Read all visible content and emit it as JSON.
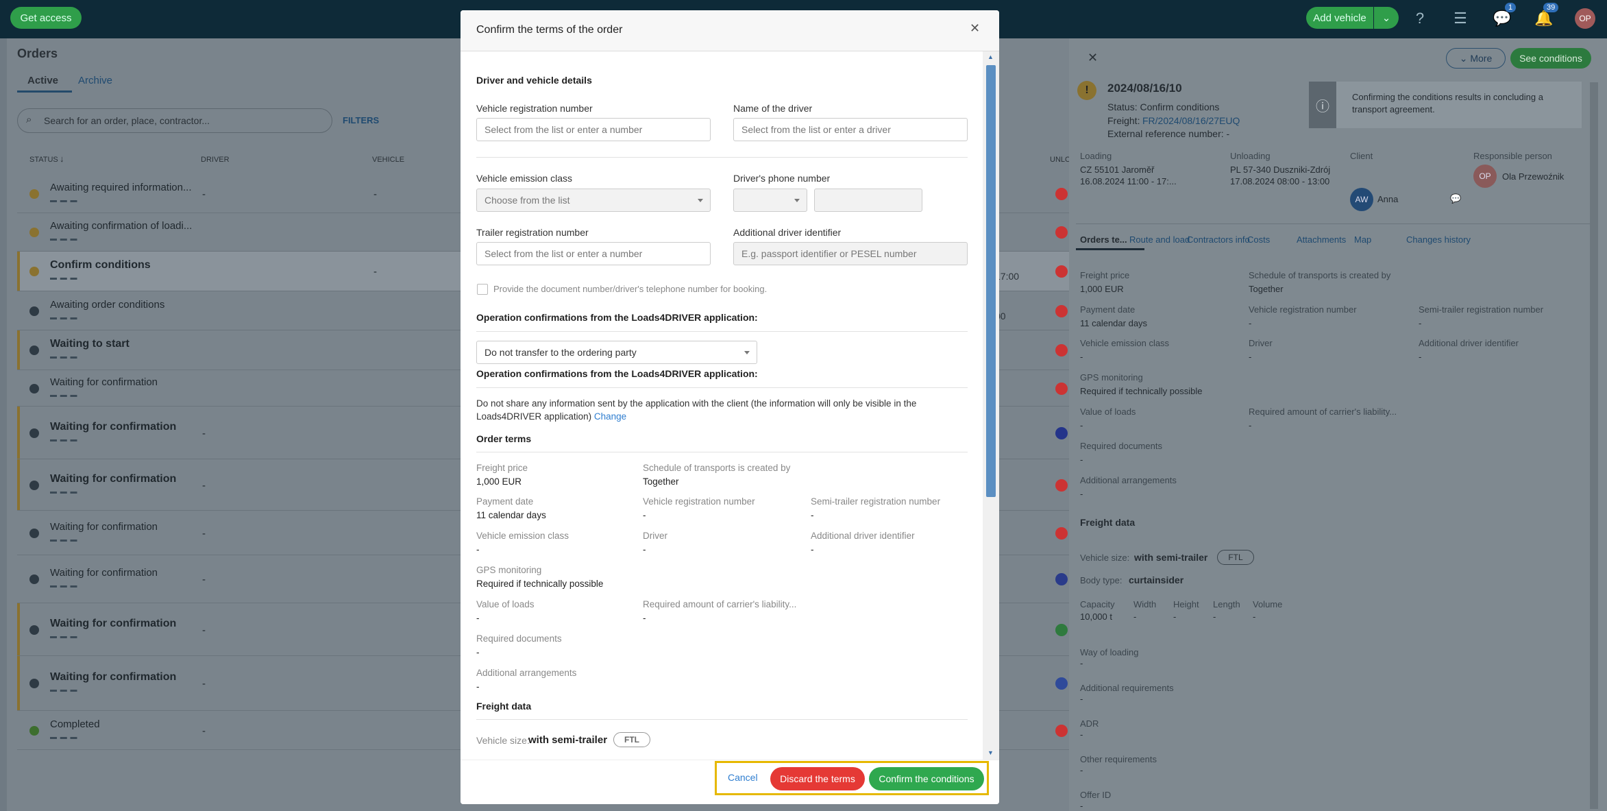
{
  "topbar": {
    "get_access": "Get access",
    "add_vehicle": "Add vehicle",
    "chat_badge": "1",
    "bell_badge": "39",
    "avatar": "OP"
  },
  "orders": {
    "title": "Orders",
    "tabs": [
      "Active",
      "Archive"
    ],
    "search_placeholder": "Search for an order, place, contractor...",
    "filters": "FILTERS",
    "columns": [
      "STATUS",
      "DRIVER",
      "VEHICLE",
      "UNLO"
    ],
    "rows": [
      {
        "status": "Awaiting required information...",
        "driver": "-",
        "vehicle": "-",
        "bold": false
      },
      {
        "status": "Awaiting confirmation of loadi...",
        "driver": "",
        "vehicle": "",
        "bold": false
      },
      {
        "status": "Confirm conditions",
        "driver": "",
        "vehicle": "-",
        "bold": true
      },
      {
        "status": "Awaiting order conditions",
        "driver": "",
        "vehicle": "",
        "bold": false
      },
      {
        "status": "Waiting to start",
        "driver": "",
        "vehicle": "",
        "bold": true
      },
      {
        "status": "Waiting for confirmation",
        "driver": "",
        "vehicle": "",
        "bold": false
      },
      {
        "status": "Waiting for confirmation",
        "driver": "-",
        "vehicle": "",
        "bold": true
      },
      {
        "status": "Waiting for confirmation",
        "driver": "-",
        "vehicle": "",
        "bold": true
      },
      {
        "status": "Waiting for confirmation",
        "driver": "-",
        "vehicle": "",
        "bold": false
      },
      {
        "status": "Waiting for confirmation",
        "driver": "-",
        "vehicle": "",
        "bold": false
      },
      {
        "status": "Waiting for confirmation",
        "driver": "-",
        "vehicle": "",
        "bold": true
      },
      {
        "status": "Waiting for confirmation",
        "driver": "-",
        "vehicle": "",
        "bold": true
      },
      {
        "status": "Completed",
        "driver": "-",
        "vehicle": "",
        "bold": false
      }
    ],
    "times": [
      "17:00",
      "00"
    ]
  },
  "modal": {
    "title": "Confirm the terms of the order",
    "section_driver": "Driver and vehicle details",
    "vehicle_reg_label": "Vehicle registration number",
    "vehicle_reg_placeholder": "Select from the list or enter a number",
    "driver_name_label": "Name of the driver",
    "driver_name_placeholder": "Select from the list or enter a driver",
    "emission_label": "Vehicle emission class",
    "emission_value": "Choose from the list",
    "phone_label": "Driver's phone number",
    "trailer_label": "Trailer registration number",
    "trailer_placeholder": "Select from the list or enter a number",
    "addid_label": "Additional driver identifier",
    "addid_placeholder": "E.g. passport identifier or PESEL number",
    "checkbox_label": "Provide the document number/driver's telephone number for booking.",
    "ops_title": "Operation confirmations from the Loads4DRIVER application:",
    "ops_select": "Do not transfer to the ordering party",
    "ops_title2": "Operation confirmations from the Loads4DRIVER application:",
    "ops_text": "Do not share any information sent by the application with the client (the information will only be visible in the Loads4DRIVER application)",
    "ops_change": "Change",
    "order_terms": "Order terms",
    "fields": [
      {
        "label": "Freight price",
        "value": "1,000 EUR"
      },
      {
        "label": "Schedule of transports is created by",
        "value": "Together"
      },
      {
        "label": "Payment date",
        "value": "11 calendar days"
      },
      {
        "label": "Vehicle registration number",
        "value": "-"
      },
      {
        "label": "Semi-trailer registration number",
        "value": "-"
      },
      {
        "label": "Vehicle emission class",
        "value": "-"
      },
      {
        "label": "Driver",
        "value": "-"
      },
      {
        "label": "Additional driver identifier",
        "value": "-"
      },
      {
        "label": "GPS monitoring",
        "value": "Required if technically possible"
      },
      {
        "label": "Value of loads",
        "value": "-"
      },
      {
        "label": "Required amount of carrier's liability...",
        "value": "-"
      },
      {
        "label": "Required documents",
        "value": "-"
      },
      {
        "label": "Additional arrangements",
        "value": "-"
      }
    ],
    "freight_data": "Freight data",
    "vehicle_size_label": "Vehicle size:",
    "vehicle_size_value": "with semi-trailer",
    "ftl": "FTL",
    "cancel": "Cancel",
    "discard": "Discard the terms",
    "confirm": "Confirm the conditions"
  },
  "right": {
    "more": "More",
    "see_conditions": "See conditions",
    "date": "2024/08/16/10",
    "status": "Status: Confirm conditions",
    "freight_label": "Freight:",
    "freight_link": "FR/2024/08/16/27EUQ",
    "ext_ref": "External reference number: -",
    "info": "Confirming the conditions results in concluding a transport agreement.",
    "loading_label": "Loading",
    "loading_place": "CZ 55101 Jaroměř",
    "loading_time": "16.08.2024 11:00 - 17:...",
    "unloading_label": "Unloading",
    "unloading_place": "PL 57-340 Duszniki-Zdrój",
    "unloading_time": "17.08.2024 08:00 - 13:00",
    "client_label": "Client",
    "client_avatar": "AW",
    "client_name": "Anna",
    "resp_label": "Responsible person",
    "resp_avatar": "OP",
    "resp_name": "Ola Przewoźnik",
    "tabs": [
      "Orders te...",
      "Route and load",
      "Contractors info",
      "Costs",
      "Attachments",
      "Map",
      "Changes history"
    ],
    "fields": [
      {
        "label": "Freight price",
        "value": "1,000 EUR"
      },
      {
        "label": "Schedule of transports is created by",
        "value": "Together"
      },
      {
        "label": "Payment date",
        "value": "11 calendar days"
      },
      {
        "label": "Vehicle registration number",
        "value": "-"
      },
      {
        "label": "Semi-trailer registration number",
        "value": "-"
      },
      {
        "label": "Vehicle emission class",
        "value": "-"
      },
      {
        "label": "Driver",
        "value": "-"
      },
      {
        "label": "Additional driver identifier",
        "value": "-"
      },
      {
        "label": "GPS monitoring",
        "value": "Required if technically possible"
      },
      {
        "label": "Value of loads",
        "value": "-"
      },
      {
        "label": "Required amount of carrier's liability...",
        "value": "-"
      },
      {
        "label": "Required documents",
        "value": "-"
      },
      {
        "label": "Additional arrangements",
        "value": "-"
      }
    ],
    "freight_data": "Freight data",
    "vehicle_size_label": "Vehicle size:",
    "vehicle_size_value": "with semi-trailer",
    "ftl": "FTL",
    "body_label": "Body type:",
    "body_value": "curtainsider",
    "dims": [
      {
        "label": "Capacity",
        "value": "10,000 t"
      },
      {
        "label": "Width",
        "value": "-"
      },
      {
        "label": "Height",
        "value": "-"
      },
      {
        "label": "Length",
        "value": "-"
      },
      {
        "label": "Volume",
        "value": "-"
      }
    ],
    "extra": [
      {
        "label": "Way of loading",
        "value": "-"
      },
      {
        "label": "Additional requirements",
        "value": "-"
      },
      {
        "label": "ADR",
        "value": "-"
      },
      {
        "label": "Other requirements",
        "value": "-"
      },
      {
        "label": "Offer ID",
        "value": "-"
      }
    ]
  }
}
